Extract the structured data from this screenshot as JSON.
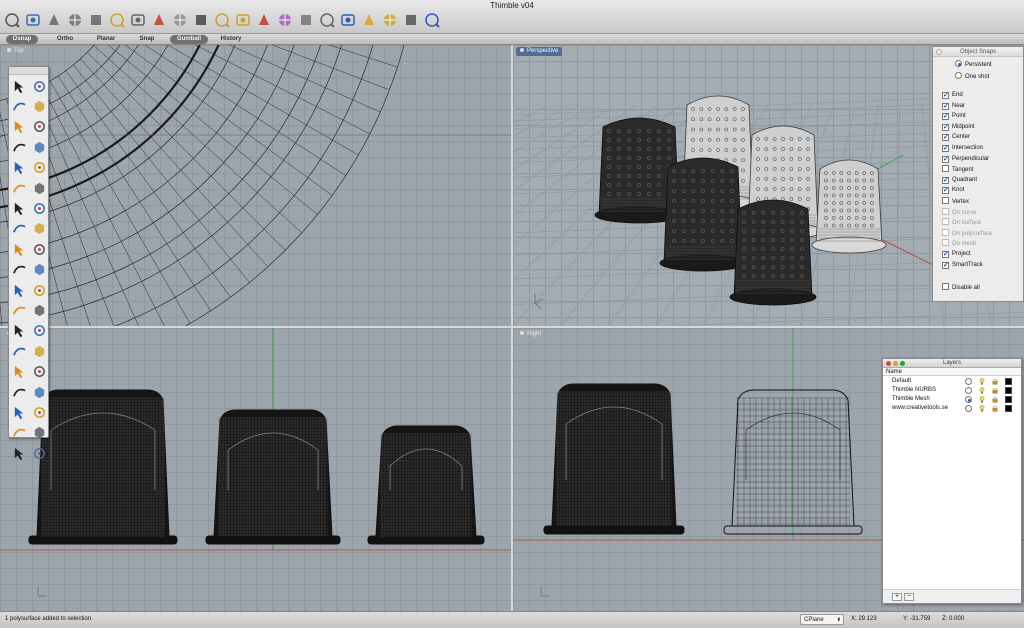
{
  "window": {
    "title": "Thimble v04"
  },
  "toolbar": {
    "icons": [
      "pan-hand",
      "rotate-view",
      "zoom",
      "zoom-window",
      "zoom-extents",
      "zoom-selected",
      "undo-view",
      "car-view",
      "shade",
      "render-preview",
      "light",
      "text-tool",
      "analyze",
      "color",
      "mesh-sphere",
      "gumball",
      "globe",
      "flag",
      "puzzle",
      "gear",
      "help"
    ]
  },
  "command_strip": {
    "osnap": "Osnap",
    "ortho": "Ortho",
    "planar": "Planar",
    "snap": "Snap",
    "gumball": "Gumball",
    "history": "History"
  },
  "viewports": {
    "top": {
      "title": "Top"
    },
    "perspective": {
      "title": "Perspective"
    },
    "front": {
      "title": ""
    },
    "right": {
      "title": "Right"
    }
  },
  "object_snaps": {
    "title": "Object Snaps",
    "modes": [
      {
        "label": "Persistent",
        "selected": true
      },
      {
        "label": "One shot",
        "selected": false
      }
    ],
    "snaps": [
      {
        "label": "End",
        "checked": true,
        "enabled": true
      },
      {
        "label": "Near",
        "checked": true,
        "enabled": true
      },
      {
        "label": "Point",
        "checked": true,
        "enabled": true
      },
      {
        "label": "Midpoint",
        "checked": true,
        "enabled": true
      },
      {
        "label": "Center",
        "checked": true,
        "enabled": true
      },
      {
        "label": "Intersection",
        "checked": true,
        "enabled": true
      },
      {
        "label": "Perpendicular",
        "checked": true,
        "enabled": true
      },
      {
        "label": "Tangent",
        "checked": false,
        "enabled": true
      },
      {
        "label": "Quadrant",
        "checked": true,
        "enabled": true
      },
      {
        "label": "Knot",
        "checked": true,
        "enabled": true
      },
      {
        "label": "Vertex",
        "checked": false,
        "enabled": true
      },
      {
        "label": "On curve",
        "checked": false,
        "enabled": false
      },
      {
        "label": "On surface",
        "checked": false,
        "enabled": false
      },
      {
        "label": "On polysurface",
        "checked": false,
        "enabled": false
      },
      {
        "label": "On mesh",
        "checked": false,
        "enabled": false
      },
      {
        "label": "Project",
        "checked": true,
        "enabled": true
      },
      {
        "label": "SmartTrack",
        "checked": true,
        "enabled": true
      }
    ],
    "disable_all": "Disable all"
  },
  "layers": {
    "title": "Layers",
    "column_name": "Name",
    "rows": [
      {
        "name": "Default",
        "current": false
      },
      {
        "name": "Thimble NURBS",
        "current": false
      },
      {
        "name": "Thimble Mesh",
        "current": true
      },
      {
        "name": "www.creativetools.se",
        "current": false
      }
    ],
    "add": "+",
    "remove": "−"
  },
  "status": {
    "message": "1 polysurface added to selection.",
    "cplane": "CPlane",
    "x": "X: 29.123",
    "y": "Y: -31.759",
    "z": "Z: 0.000"
  },
  "colors": {
    "viewport_bg": "#9ca4ac",
    "active_viewport_tab": "#4d6f97",
    "x_axis": "#c0392b",
    "y_axis": "#2e9e3e"
  }
}
